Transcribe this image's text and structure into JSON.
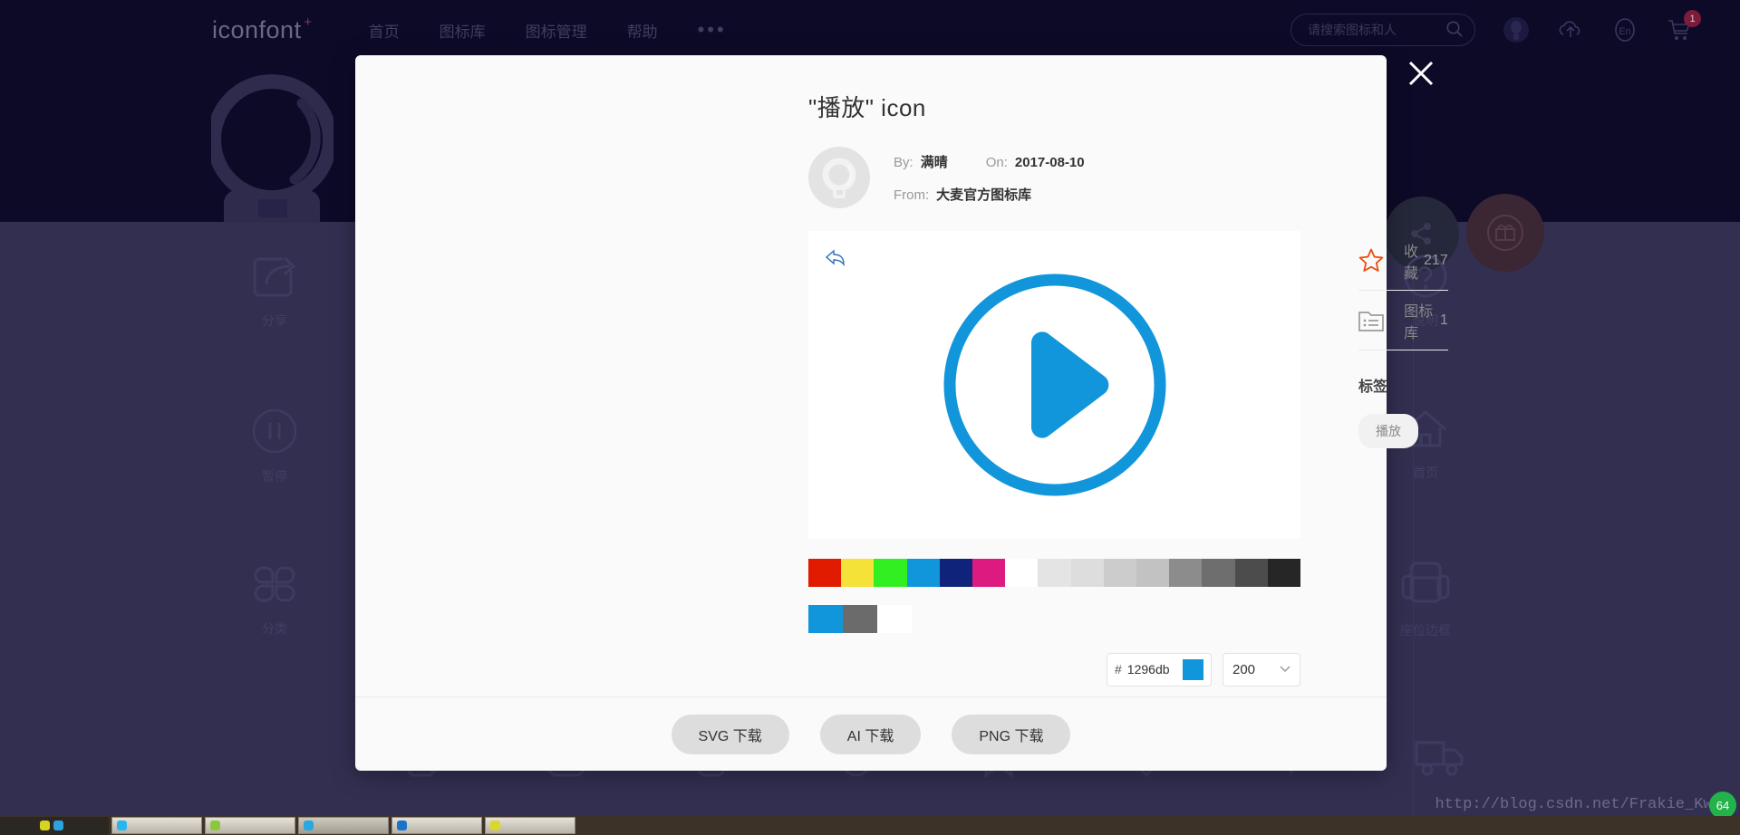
{
  "site": {
    "brand": "iconfont",
    "brand_plus": "+",
    "nav_links": [
      "首页",
      "图标库",
      "图标管理",
      "帮助"
    ],
    "nav_more": "•••",
    "search_placeholder": "请搜索图标和人",
    "search_icon": "search-icon",
    "upload_icon": "cloud-upload-icon",
    "lang_icon": "language-en-icon",
    "cart_icon": "shopping-cart-icon",
    "cart_badge": "1",
    "avatar_icon": "user-avatar-icon",
    "watermark": "http://blog.csdn.net/Frakie_Kwok",
    "corner_badge": "64"
  },
  "background_grid": {
    "items": [
      {
        "label": "分享",
        "icon": "share-box-icon",
        "col": 0,
        "row": 0
      },
      {
        "label": "说明",
        "icon": "question-circle-icon",
        "col": 3,
        "row": 0
      },
      {
        "label": "暂停",
        "icon": "pause-circle-icon",
        "col": 0,
        "row": 1
      },
      {
        "label": "首页",
        "icon": "home-icon",
        "col": 3,
        "row": 1
      },
      {
        "label": "分类",
        "icon": "category-grid-icon",
        "col": 0,
        "row": 2
      },
      {
        "label": "座位边框",
        "icon": "seat-frame-icon",
        "col": 3,
        "row": 2
      }
    ],
    "bottom_icons": [
      "seat-person-icon",
      "checkbox-check-icon",
      "rounded-rect-icon",
      "user-circle-icon",
      "bookmark-plus-icon",
      "location-pin-icon",
      "yuan-currency-icon",
      "truck-icon",
      "app-square-icon"
    ],
    "fab_share": "share-node-icon",
    "fab_gift": "gift-circle-icon",
    "hero_icon": "crystal-ball-icon"
  },
  "modal": {
    "close_icon": "close-icon",
    "title": "\"播放\" icon",
    "avatar_icon": "author-avatar-icon",
    "by_label": "By:",
    "by_value": "满晴",
    "on_label": "On:",
    "on_value": "2017-08-10",
    "from_label": "From:",
    "from_value": "大麦官方图标库",
    "preview": {
      "icon": "play-circle-icon",
      "color": "#1296db",
      "cursor_icon": "back-arrow-cursor"
    },
    "palette": {
      "row1": [
        "#e01b00",
        "#f5e238",
        "#32ef22",
        "#1296db",
        "#10237a",
        "#dd1a7f",
        "#ffffff",
        "#e4e4e4",
        "#dddddd",
        "#cccccc",
        "#c2c2c2",
        "#8c8c8c",
        "#6e6e6e",
        "#4c4c4c",
        "#262626"
      ],
      "row2": [
        "#1296db",
        "#6b6b6b",
        "#ffffff"
      ],
      "selected": "#1296db"
    },
    "hex": {
      "hash": "#",
      "value": "1296db",
      "chip": "#1296db"
    },
    "size": {
      "value": "200",
      "chevron_icon": "chevron-down-icon"
    },
    "sidebar": {
      "rows": [
        {
          "icon": "star-outline-icon",
          "label": "收藏",
          "count": "217"
        },
        {
          "icon": "folder-list-icon",
          "label": "图标库",
          "count": "1"
        }
      ],
      "tags_title": "标签",
      "tags": [
        "播放"
      ]
    },
    "footer_buttons": [
      "SVG 下载",
      "AI 下载",
      "PNG 下载"
    ]
  }
}
